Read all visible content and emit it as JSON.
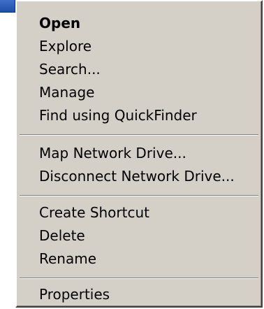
{
  "context_menu": {
    "items": [
      {
        "label": "Open"
      },
      {
        "label": "Explore"
      },
      {
        "label": "Search..."
      },
      {
        "label": "Manage"
      },
      {
        "label": "Find using QuickFinder"
      },
      {
        "label": "Map Network Drive..."
      },
      {
        "label": "Disconnect Network Drive..."
      },
      {
        "label": "Create Shortcut"
      },
      {
        "label": "Delete"
      },
      {
        "label": "Rename"
      },
      {
        "label": "Properties"
      }
    ]
  },
  "colors": {
    "menu_bg": "#d4d0c8",
    "text": "#000000",
    "corner_icon": "#2a5cbf"
  }
}
